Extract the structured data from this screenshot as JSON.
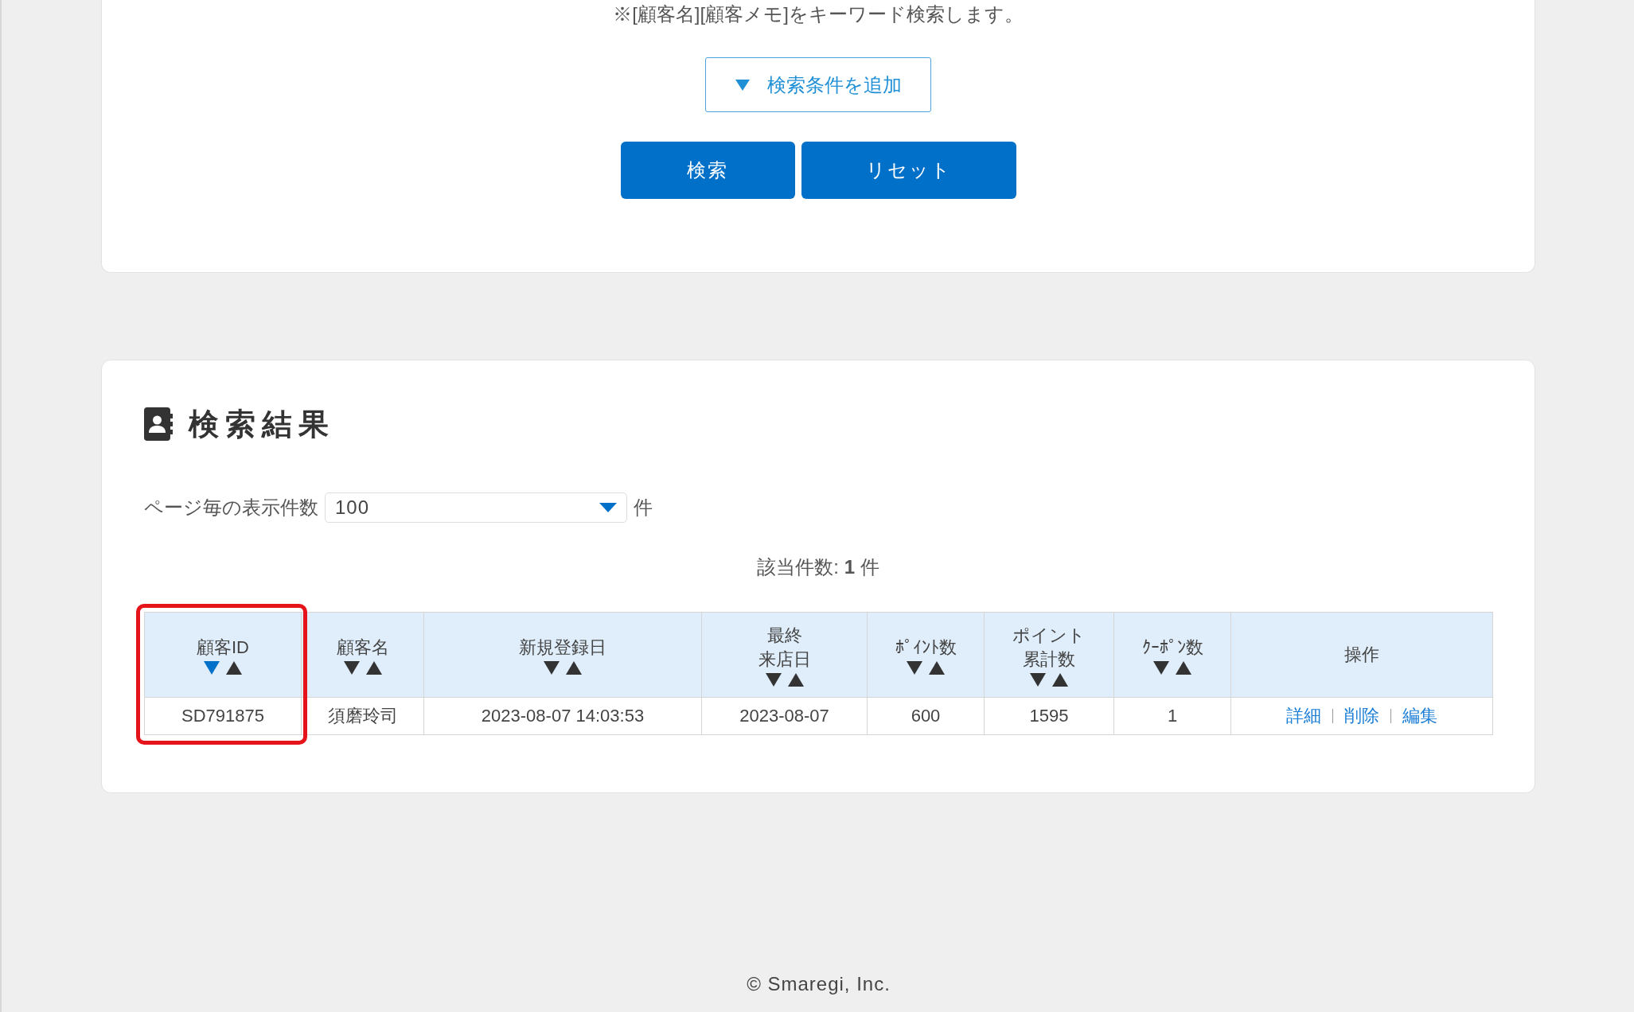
{
  "search_panel": {
    "note": "※[顧客名][顧客メモ]をキーワード検索します。",
    "add_condition_button": "検索条件を追加",
    "buttons": [
      "検索",
      "リセット"
    ]
  },
  "results": {
    "title": "検索結果",
    "per_page": {
      "label": "ページ毎の表示件数",
      "value": "100",
      "unit": "件"
    },
    "count": "該当件数: **1** 件",
    "table": {
      "columns": [
        {
          "label_lines": [
            "顧客ID"
          ],
          "sortable": true,
          "sorted_descending": true,
          "highlighted": true
        },
        {
          "label_lines": [
            "顧客名"
          ],
          "sortable": true,
          "sorted_descending": false,
          "highlighted": false
        },
        {
          "label_lines": [
            "新規登録日"
          ],
          "sortable": true,
          "sorted_descending": false,
          "highlighted": false
        },
        {
          "label_lines": [
            "最終",
            "来店日"
          ],
          "sortable": true,
          "sorted_descending": false,
          "highlighted": false
        },
        {
          "label_lines": [
            "ﾎﾟｲﾝﾄ数"
          ],
          "sortable": true,
          "sorted_descending": false,
          "highlighted": false
        },
        {
          "label_lines": [
            "ポイント",
            "累計数"
          ],
          "sortable": true,
          "sorted_descending": false,
          "highlighted": false
        },
        {
          "label_lines": [
            "ｸｰﾎﾟﾝ数"
          ],
          "sortable": true,
          "sorted_descending": false,
          "highlighted": false
        },
        {
          "label_lines": [
            "操作"
          ],
          "sortable": false,
          "highlighted": false
        }
      ],
      "rows": [
        {
          "cells": [
            "SD791875",
            "須磨玲司",
            "2023-08-07 14:03:53",
            "2023-08-07",
            "600",
            "1595",
            "1"
          ],
          "actions": [
            "詳細",
            "削除",
            "編集"
          ]
        }
      ]
    }
  },
  "footer": "© Smaregi, Inc."
}
